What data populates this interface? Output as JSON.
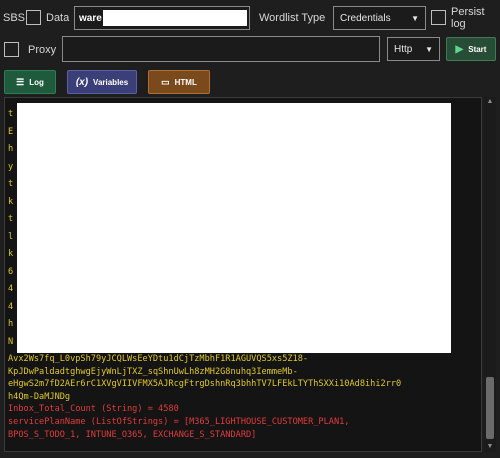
{
  "top": {
    "sbs_label": "SBS",
    "data_label": "Data",
    "data_value": "ware",
    "wordlist_type_label": "Wordlist Type",
    "wordlist_type_value": "Credentials",
    "persist_log_label": "Persist log"
  },
  "second": {
    "proxy_label": "Proxy",
    "proxy_value": "",
    "proxy_type_value": "Http",
    "start_label": "Start"
  },
  "tabs": {
    "log_label": "Log",
    "variables_label": "Variables",
    "variables_icon": "(x)",
    "html_label": "HTML"
  },
  "log": {
    "lines": [
      {
        "text": "Avx2Ws7fq_L0vpSh79yJCQLWsEeYDtu1dCjTzMbhF1R1AGUVQS5xs5Z18-",
        "color": "#e1c829"
      },
      {
        "text": "KpJDwPaldadtghwgEjyWnLjTXZ_sqShnUwLh8zMH2G8nuhq3IemmeMb-",
        "color": "#e1c829"
      },
      {
        "text": "eHgwS2m7fD2AEr6rC1XVgVIIVFMX5AJRcgFtrgDshnRq3bhhTV7LFEkLTYThSXXi10Ad8ihi2rr0",
        "color": "#e1c829"
      },
      {
        "text": "h4Qm-DaMJNDg",
        "color": "#e1c829"
      },
      {
        "text": "Inbox_Total_Count (String) = 4580",
        "color": "#e23b3b"
      },
      {
        "text": "servicePlanName (ListOfStrings) = [M365_LIGHTHOUSE_CUSTOMER_PLAN1,",
        "color": "#e23b3b"
      },
      {
        "text": "BPOS_S_TODO_1, INTUNE_O365, EXCHANGE_S_STANDARD]",
        "color": "#e23b3b"
      }
    ],
    "left_fragments": [
      "t",
      "E",
      "h",
      "y",
      "t",
      "k",
      "t",
      "l",
      "k",
      "6",
      "4",
      "4",
      "h",
      "N"
    ]
  },
  "colors": {
    "log_green": "#1f5a3c",
    "variables_purple": "#3a3f78",
    "html_orange": "#7a4a1c",
    "text_yellow": "#e1c829",
    "text_red": "#e23b3b"
  }
}
